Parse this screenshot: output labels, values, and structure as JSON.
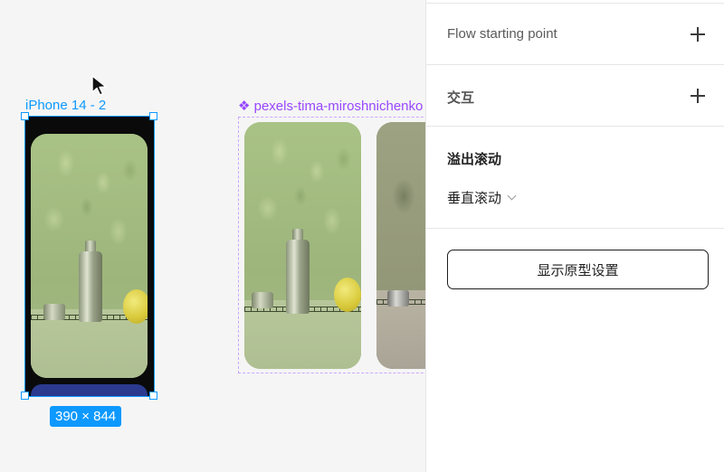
{
  "canvas": {
    "frame": {
      "label": "iPhone 14 - 2",
      "size": "390 × 844"
    },
    "component": {
      "label": "❖ pexels-tima-miroshnichenko"
    },
    "colors": {
      "selection": "#0d99ff",
      "component": "#9747ff"
    }
  },
  "panel": {
    "flow": {
      "label": "Flow starting point",
      "icon": "plus-icon"
    },
    "interaction": {
      "label": "交互",
      "icon": "plus-icon"
    },
    "overflow": {
      "title": "溢出滚动",
      "value": "垂直滚动",
      "icon": "chevron-down-icon"
    },
    "prototype_button": "显示原型设置"
  }
}
